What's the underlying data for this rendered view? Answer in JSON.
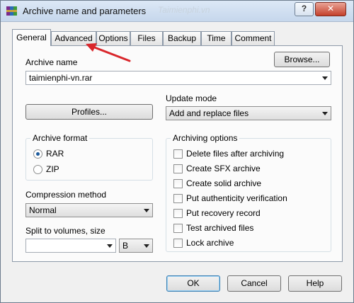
{
  "window": {
    "title": "Archive name and parameters",
    "help_glyph": "?",
    "close_glyph": "✕",
    "watermark": "Taimienphi.vn"
  },
  "tabs": [
    {
      "label": "General",
      "active": true
    },
    {
      "label": "Advanced",
      "active": false
    },
    {
      "label": "Options",
      "active": false
    },
    {
      "label": "Files",
      "active": false
    },
    {
      "label": "Backup",
      "active": false
    },
    {
      "label": "Time",
      "active": false
    },
    {
      "label": "Comment",
      "active": false
    }
  ],
  "general": {
    "archive_name_label": "Archive name",
    "archive_name_value": "taimienphi-vn.rar",
    "browse_label": "Browse...",
    "profiles_label": "Profiles...",
    "update_mode_label": "Update mode",
    "update_mode_value": "Add and replace files",
    "archive_format": {
      "title": "Archive format",
      "options": [
        {
          "label": "RAR",
          "selected": true
        },
        {
          "label": "ZIP",
          "selected": false
        }
      ]
    },
    "compression_method_label": "Compression method",
    "compression_method_value": "Normal",
    "split_label": "Split to volumes, size",
    "split_value": "",
    "split_unit": "B",
    "archiving_options": {
      "title": "Archiving options",
      "items": [
        {
          "label": "Delete files after archiving",
          "checked": false
        },
        {
          "label": "Create SFX archive",
          "checked": false
        },
        {
          "label": "Create solid archive",
          "checked": false
        },
        {
          "label": "Put authenticity verification",
          "checked": false
        },
        {
          "label": "Put recovery record",
          "checked": false
        },
        {
          "label": "Test archived files",
          "checked": false
        },
        {
          "label": "Lock archive",
          "checked": false
        }
      ]
    }
  },
  "buttons": {
    "ok": "OK",
    "cancel": "Cancel",
    "help": "Help"
  },
  "colors": {
    "annotation_arrow": "#d9262b",
    "radio_dot": "#1c5a9c"
  },
  "icons": {
    "app": "winrar-books-icon",
    "annotation": "red-arrow-icon"
  }
}
